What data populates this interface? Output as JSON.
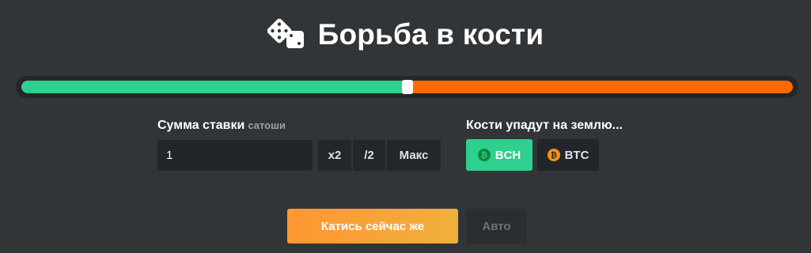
{
  "header": {
    "title": "Борьба в кости",
    "icon": "dice-icon"
  },
  "odds_bar": {
    "win_fraction": 0.5,
    "win_color": "#2ed08e",
    "lose_color": "#ff6a00"
  },
  "bet": {
    "label": "Сумма ставки",
    "unit": "сатоши",
    "amount": "1",
    "double_label": "x2",
    "half_label": "/2",
    "max_label": "Макс"
  },
  "coin": {
    "label": "Кости упадут на землю...",
    "options": [
      {
        "label": "BCH",
        "icon": "bitcoin-cash-icon",
        "color": "#2ed08e",
        "selected": true
      },
      {
        "label": "BTC",
        "icon": "bitcoin-icon",
        "color": "#f7931a",
        "selected": false
      }
    ]
  },
  "actions": {
    "roll_label": "Катись сейчас же",
    "auto_label": "Авто"
  }
}
